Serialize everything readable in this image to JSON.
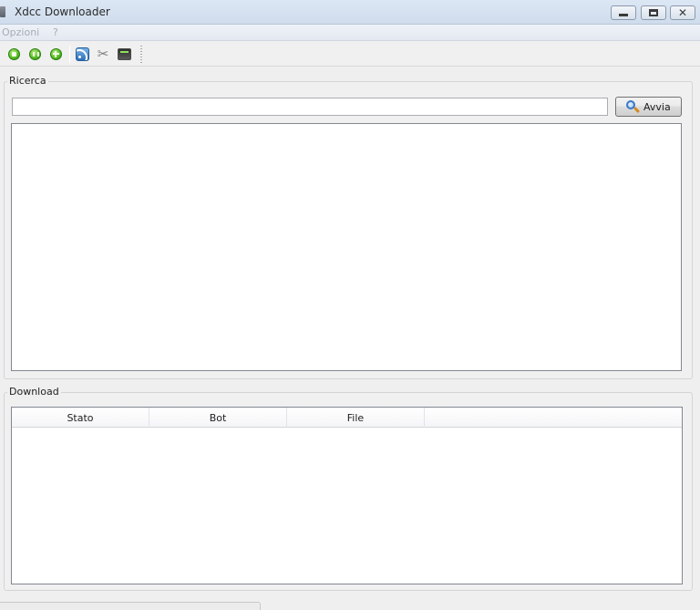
{
  "window": {
    "title": "Xdcc Downloader",
    "app_icon": "app-icon",
    "controls": {
      "minimize": "minimize-icon",
      "maximize": "maximize-icon",
      "close": "close-icon"
    }
  },
  "menubar": {
    "items": [
      {
        "label": "Opzioni"
      },
      {
        "label": "?"
      }
    ]
  },
  "toolbar": {
    "buttons": [
      {
        "icon": "play-icon"
      },
      {
        "icon": "pause-icon"
      },
      {
        "icon": "add-icon"
      },
      {
        "icon": "rss-icon"
      },
      {
        "icon": "tools-icon"
      },
      {
        "icon": "monitor-icon"
      }
    ]
  },
  "search": {
    "group_title": "Ricerca",
    "input_value": "",
    "button_label": "Avvia",
    "button_icon": "magnifier-icon",
    "results": []
  },
  "download": {
    "group_title": "Download",
    "columns": [
      "Stato",
      "Bot",
      "File",
      ""
    ],
    "rows": []
  },
  "colors": {
    "titlebar": "#dce7f4",
    "background": "#efefef",
    "accent": "#3a78c9"
  }
}
